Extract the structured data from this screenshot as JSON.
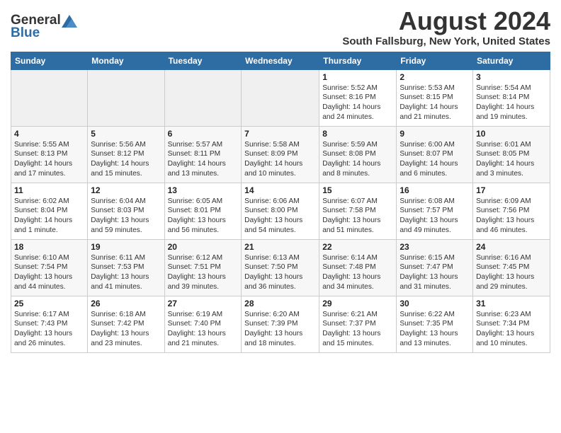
{
  "header": {
    "logo_general": "General",
    "logo_blue": "Blue",
    "month_year": "August 2024",
    "location": "South Fallsburg, New York, United States"
  },
  "weekdays": [
    "Sunday",
    "Monday",
    "Tuesday",
    "Wednesday",
    "Thursday",
    "Friday",
    "Saturday"
  ],
  "weeks": [
    [
      {
        "day": "",
        "info": ""
      },
      {
        "day": "",
        "info": ""
      },
      {
        "day": "",
        "info": ""
      },
      {
        "day": "",
        "info": ""
      },
      {
        "day": "1",
        "info": "Sunrise: 5:52 AM\nSunset: 8:16 PM\nDaylight: 14 hours\nand 24 minutes."
      },
      {
        "day": "2",
        "info": "Sunrise: 5:53 AM\nSunset: 8:15 PM\nDaylight: 14 hours\nand 21 minutes."
      },
      {
        "day": "3",
        "info": "Sunrise: 5:54 AM\nSunset: 8:14 PM\nDaylight: 14 hours\nand 19 minutes."
      }
    ],
    [
      {
        "day": "4",
        "info": "Sunrise: 5:55 AM\nSunset: 8:13 PM\nDaylight: 14 hours\nand 17 minutes."
      },
      {
        "day": "5",
        "info": "Sunrise: 5:56 AM\nSunset: 8:12 PM\nDaylight: 14 hours\nand 15 minutes."
      },
      {
        "day": "6",
        "info": "Sunrise: 5:57 AM\nSunset: 8:11 PM\nDaylight: 14 hours\nand 13 minutes."
      },
      {
        "day": "7",
        "info": "Sunrise: 5:58 AM\nSunset: 8:09 PM\nDaylight: 14 hours\nand 10 minutes."
      },
      {
        "day": "8",
        "info": "Sunrise: 5:59 AM\nSunset: 8:08 PM\nDaylight: 14 hours\nand 8 minutes."
      },
      {
        "day": "9",
        "info": "Sunrise: 6:00 AM\nSunset: 8:07 PM\nDaylight: 14 hours\nand 6 minutes."
      },
      {
        "day": "10",
        "info": "Sunrise: 6:01 AM\nSunset: 8:05 PM\nDaylight: 14 hours\nand 3 minutes."
      }
    ],
    [
      {
        "day": "11",
        "info": "Sunrise: 6:02 AM\nSunset: 8:04 PM\nDaylight: 14 hours\nand 1 minute."
      },
      {
        "day": "12",
        "info": "Sunrise: 6:04 AM\nSunset: 8:03 PM\nDaylight: 13 hours\nand 59 minutes."
      },
      {
        "day": "13",
        "info": "Sunrise: 6:05 AM\nSunset: 8:01 PM\nDaylight: 13 hours\nand 56 minutes."
      },
      {
        "day": "14",
        "info": "Sunrise: 6:06 AM\nSunset: 8:00 PM\nDaylight: 13 hours\nand 54 minutes."
      },
      {
        "day": "15",
        "info": "Sunrise: 6:07 AM\nSunset: 7:58 PM\nDaylight: 13 hours\nand 51 minutes."
      },
      {
        "day": "16",
        "info": "Sunrise: 6:08 AM\nSunset: 7:57 PM\nDaylight: 13 hours\nand 49 minutes."
      },
      {
        "day": "17",
        "info": "Sunrise: 6:09 AM\nSunset: 7:56 PM\nDaylight: 13 hours\nand 46 minutes."
      }
    ],
    [
      {
        "day": "18",
        "info": "Sunrise: 6:10 AM\nSunset: 7:54 PM\nDaylight: 13 hours\nand 44 minutes."
      },
      {
        "day": "19",
        "info": "Sunrise: 6:11 AM\nSunset: 7:53 PM\nDaylight: 13 hours\nand 41 minutes."
      },
      {
        "day": "20",
        "info": "Sunrise: 6:12 AM\nSunset: 7:51 PM\nDaylight: 13 hours\nand 39 minutes."
      },
      {
        "day": "21",
        "info": "Sunrise: 6:13 AM\nSunset: 7:50 PM\nDaylight: 13 hours\nand 36 minutes."
      },
      {
        "day": "22",
        "info": "Sunrise: 6:14 AM\nSunset: 7:48 PM\nDaylight: 13 hours\nand 34 minutes."
      },
      {
        "day": "23",
        "info": "Sunrise: 6:15 AM\nSunset: 7:47 PM\nDaylight: 13 hours\nand 31 minutes."
      },
      {
        "day": "24",
        "info": "Sunrise: 6:16 AM\nSunset: 7:45 PM\nDaylight: 13 hours\nand 29 minutes."
      }
    ],
    [
      {
        "day": "25",
        "info": "Sunrise: 6:17 AM\nSunset: 7:43 PM\nDaylight: 13 hours\nand 26 minutes."
      },
      {
        "day": "26",
        "info": "Sunrise: 6:18 AM\nSunset: 7:42 PM\nDaylight: 13 hours\nand 23 minutes."
      },
      {
        "day": "27",
        "info": "Sunrise: 6:19 AM\nSunset: 7:40 PM\nDaylight: 13 hours\nand 21 minutes."
      },
      {
        "day": "28",
        "info": "Sunrise: 6:20 AM\nSunset: 7:39 PM\nDaylight: 13 hours\nand 18 minutes."
      },
      {
        "day": "29",
        "info": "Sunrise: 6:21 AM\nSunset: 7:37 PM\nDaylight: 13 hours\nand 15 minutes."
      },
      {
        "day": "30",
        "info": "Sunrise: 6:22 AM\nSunset: 7:35 PM\nDaylight: 13 hours\nand 13 minutes."
      },
      {
        "day": "31",
        "info": "Sunrise: 6:23 AM\nSunset: 7:34 PM\nDaylight: 13 hours\nand 10 minutes."
      }
    ]
  ]
}
